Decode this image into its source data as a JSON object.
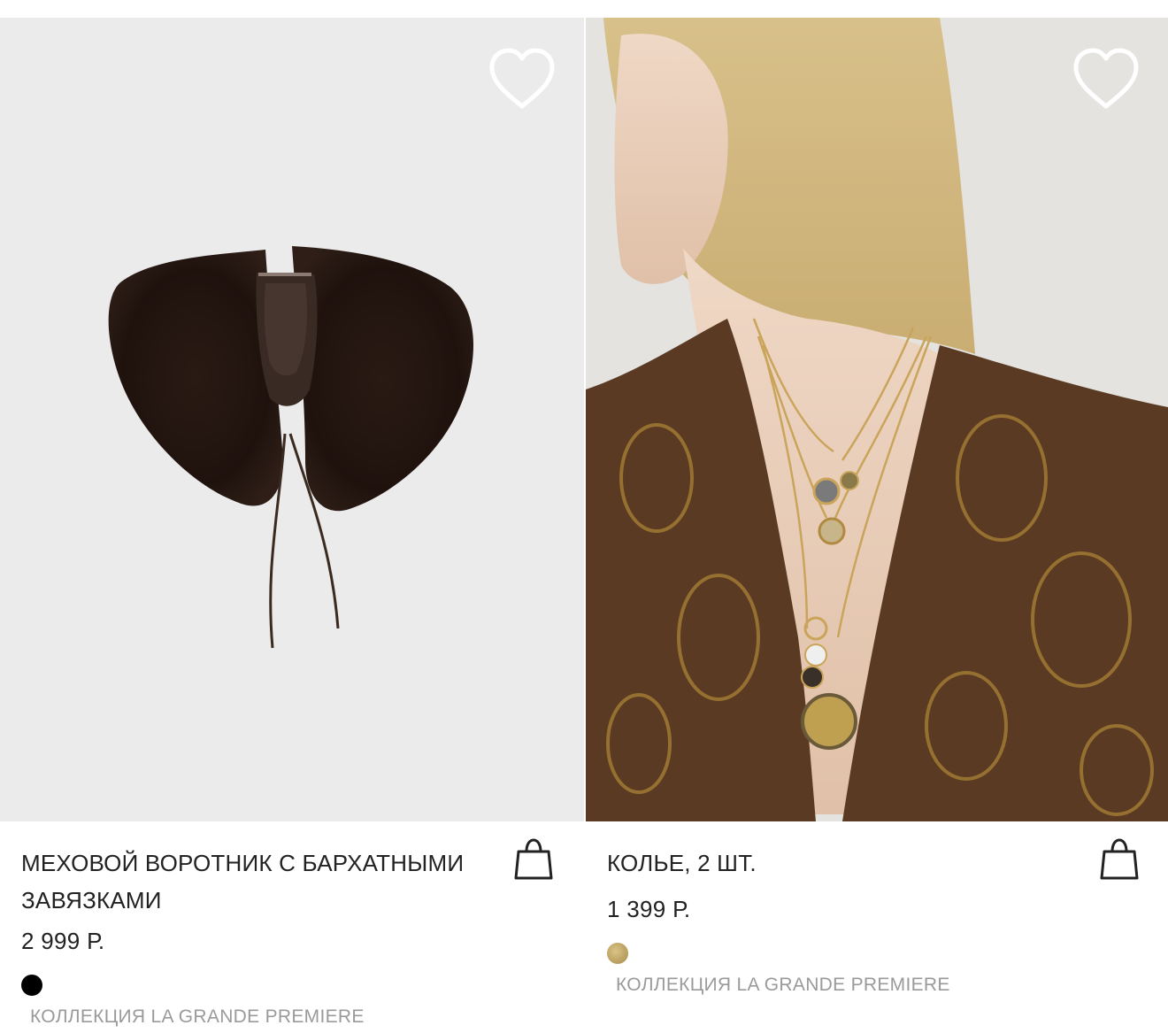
{
  "products": [
    {
      "title": "МЕХОВОЙ ВОРОТНИК С БАРХАТНЫМИ ЗАВЯЗКАМИ",
      "price": "2 999 Р.",
      "swatch_color": "#000000",
      "collection": "КОЛЛЕКЦИЯ LA GRANDE PREMIERE",
      "favorite_icon": "heart-outline-icon",
      "cart_icon": "shopping-bag-icon"
    },
    {
      "title": "КОЛЬЕ, 2 ШТ.",
      "price": "1 399 Р.",
      "swatch_color": "#b39a5e",
      "collection": "КОЛЛЕКЦИЯ LA GRANDE PREMIERE",
      "favorite_icon": "heart-outline-icon",
      "cart_icon": "shopping-bag-icon"
    }
  ]
}
